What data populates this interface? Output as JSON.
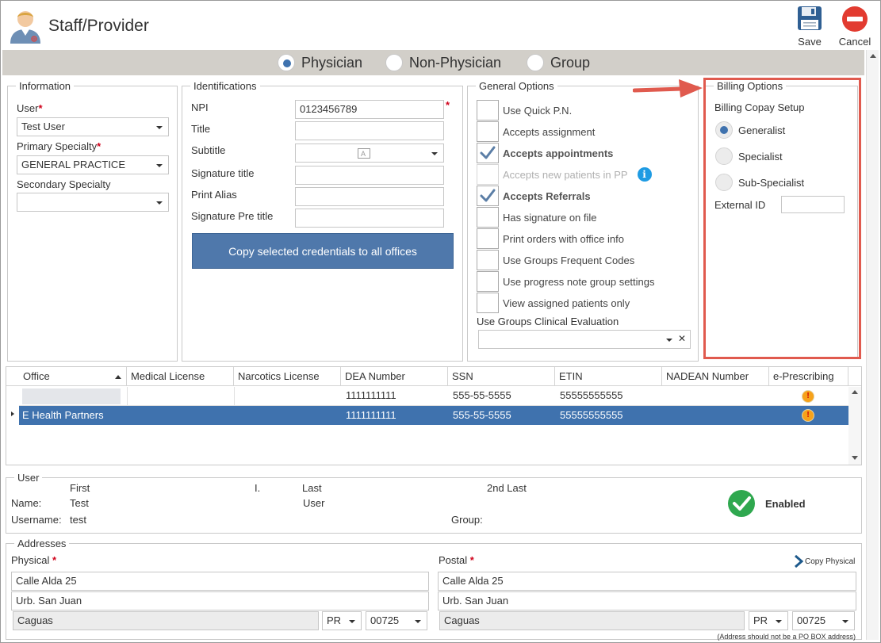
{
  "header": {
    "title": "Staff/Provider",
    "save_label": "Save",
    "cancel_label": "Cancel"
  },
  "provider_type": {
    "options": [
      "Physician",
      "Non-Physician",
      "Group"
    ],
    "selected": "Physician"
  },
  "information": {
    "legend": "Information",
    "user_label": "User",
    "user_value": "Test User",
    "primary_specialty_label": "Primary Specialty",
    "primary_specialty_value": "GENERAL PRACTICE",
    "secondary_specialty_label": "Secondary Specialty",
    "secondary_specialty_value": ""
  },
  "identifications": {
    "legend": "Identifications",
    "npi_label": "NPI",
    "npi_value": "0123456789",
    "title_label": "Title",
    "title_value": "",
    "subtitle_label": "Subtitle",
    "subtitle_value": "",
    "signature_title_label": "Signature title",
    "signature_title_value": "",
    "print_alias_label": "Print Alias",
    "print_alias_value": "",
    "signature_pre_title_label": "Signature Pre title",
    "signature_pre_title_value": "",
    "copy_button": "Copy selected credentials to all offices"
  },
  "general_options": {
    "legend": "General Options",
    "items": [
      {
        "label": "Use Quick P.N.",
        "checked": false,
        "style": "normal"
      },
      {
        "label": "Accepts assignment",
        "checked": false,
        "style": "normal"
      },
      {
        "label": "Accepts appointments",
        "checked": true,
        "style": "bold"
      },
      {
        "label": "Accepts new patients in PP",
        "checked": false,
        "style": "disabled"
      },
      {
        "label": "Accepts Referrals",
        "checked": true,
        "style": "bold"
      },
      {
        "label": "Has signature on file",
        "checked": false,
        "style": "normal"
      },
      {
        "label": "Print orders with office info",
        "checked": false,
        "style": "normal"
      },
      {
        "label": "Use Groups Frequent Codes",
        "checked": false,
        "style": "normal"
      },
      {
        "label": "Use progress note group settings",
        "checked": false,
        "style": "normal"
      },
      {
        "label": "View assigned patients only",
        "checked": false,
        "style": "normal"
      }
    ],
    "clinical_eval_label": "Use Groups Clinical Evaluation",
    "clinical_eval_value": "",
    "clear_glyph": "✕"
  },
  "billing_options": {
    "legend": "Billing Options",
    "copay_label": "Billing Copay Setup",
    "options": [
      "Generalist",
      "Specialist",
      "Sub-Specialist"
    ],
    "selected": "Generalist",
    "external_id_label": "External ID",
    "external_id_value": "",
    "highlight_color": "#e05a4e"
  },
  "offices_grid": {
    "columns": [
      "Office",
      "Medical License",
      "Narcotics License",
      "DEA Number",
      "SSN",
      "ETIN",
      "NADEAN Number",
      "e-Prescribing"
    ],
    "rows": [
      {
        "office": "",
        "medical_license": "",
        "narcotics_license": "",
        "dea": "1111111111",
        "ssn": "555-55-5555",
        "etin": "55555555555",
        "nadean": "",
        "eprescribing_icon": "!",
        "selected": false
      },
      {
        "office": "E Health Partners",
        "medical_license": "",
        "narcotics_license": "",
        "dea": "1111111111",
        "ssn": "555-55-5555",
        "etin": "55555555555",
        "nadean": "",
        "eprescribing_icon": "!",
        "selected": true
      }
    ]
  },
  "user_section": {
    "legend": "User",
    "first_label": "First",
    "initial_label": "I.",
    "last_label": "Last",
    "second_last_label": "2nd Last",
    "name_label": "Name:",
    "first_value": "Test",
    "last_value": "User",
    "username_label": "Username:",
    "username_value": "test",
    "group_label": "Group:",
    "group_value": "",
    "status_label": "Enabled"
  },
  "addresses": {
    "legend": "Addresses",
    "physical_label": "Physical",
    "postal_label": "Postal",
    "copy_physical": "Copy Physical",
    "physical": {
      "line1": "Calle Alda 25",
      "line2": "Urb. San Juan",
      "city": "Caguas",
      "state": "PR",
      "zip": "00725"
    },
    "postal": {
      "line1": "Calle Alda 25",
      "line2": "Urb. San Juan",
      "city": "Caguas",
      "state": "PR",
      "zip": "00725"
    },
    "note": "(Address should not be a PO BOX address)"
  }
}
